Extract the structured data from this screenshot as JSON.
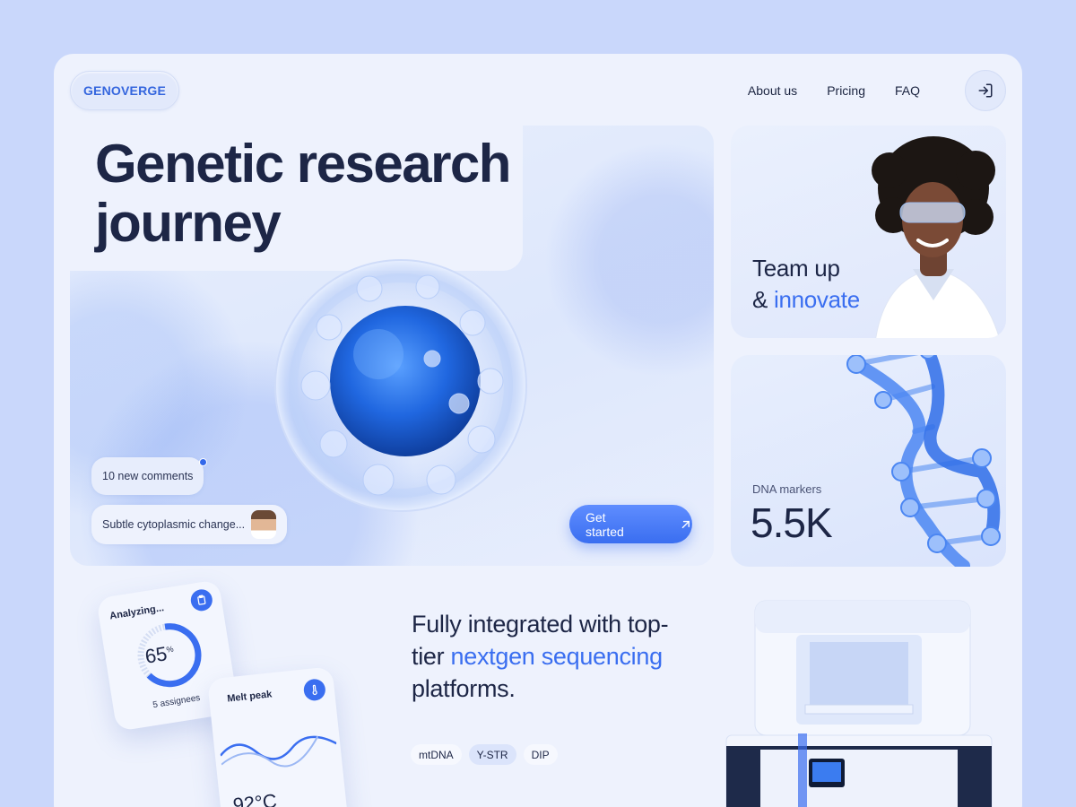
{
  "brand": {
    "name": "GENOVERGE"
  },
  "nav": {
    "items": [
      "About us",
      "Pricing",
      "FAQ"
    ]
  },
  "hero": {
    "title_line1": "Genetic research",
    "title_line2": "journey",
    "comments_badge": "10 new comments",
    "comment_preview": "Subtle cytoplasmic change...",
    "cta": "Get started"
  },
  "team": {
    "line1": "Team up",
    "line2_prefix": "& ",
    "line2_accent": "innovate"
  },
  "dna": {
    "label": "DNA markers",
    "value": "5.5K"
  },
  "analysis": {
    "title": "Analyzing...",
    "percent": "65",
    "percent_sign": "%",
    "progress_fraction": 0.65,
    "assignees": "5 assignees"
  },
  "melt": {
    "title": "Melt peak",
    "temperature": "92°C"
  },
  "tagline": {
    "line1": "Fully integrated with top-",
    "line2_prefix": "tier ",
    "line2_accent": "nextgen sequencing",
    "line3": "platforms."
  },
  "tags": {
    "items": [
      "mtDNA",
      "Y-STR",
      "DIP"
    ],
    "selected": "Y-STR"
  },
  "colors": {
    "accent": "#3a6ef0",
    "background": "#c9d7fb",
    "panel": "#eef2fd",
    "text": "#1d2646"
  },
  "icons": {
    "login": "login-icon",
    "arrow": "arrow-up-right-icon",
    "clipboard": "clipboard-icon",
    "thermometer": "thermometer-icon"
  }
}
